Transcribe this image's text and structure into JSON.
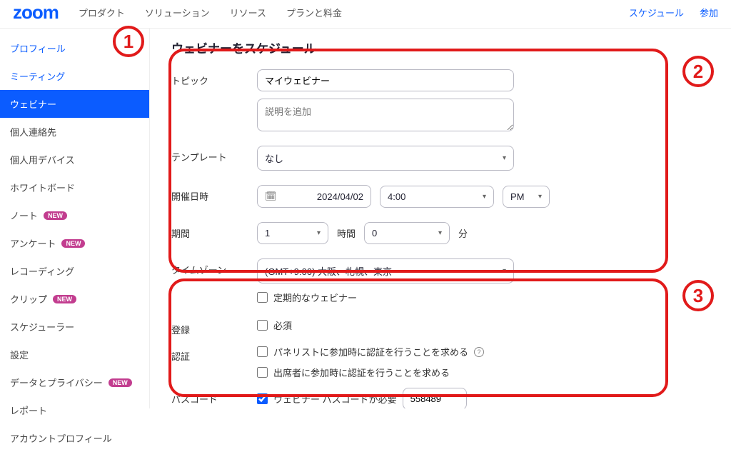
{
  "brand": "zoom",
  "topnav": {
    "links": [
      "プロダクト",
      "ソリューション",
      "リソース",
      "プランと料金"
    ],
    "right": [
      "スケジュール",
      "参加"
    ]
  },
  "sidebar": {
    "items": [
      {
        "label": "プロフィール",
        "active": false,
        "linkish": true,
        "new": false
      },
      {
        "label": "ミーティング",
        "active": false,
        "linkish": true,
        "new": false
      },
      {
        "label": "ウェビナー",
        "active": true,
        "linkish": false,
        "new": false
      },
      {
        "label": "個人連絡先",
        "active": false,
        "linkish": false,
        "new": false
      },
      {
        "label": "個人用デバイス",
        "active": false,
        "linkish": false,
        "new": false
      },
      {
        "label": "ホワイトボード",
        "active": false,
        "linkish": false,
        "new": false
      },
      {
        "label": "ノート",
        "active": false,
        "linkish": false,
        "new": true
      },
      {
        "label": "アンケート",
        "active": false,
        "linkish": false,
        "new": true
      },
      {
        "label": "レコーディング",
        "active": false,
        "linkish": false,
        "new": false
      },
      {
        "label": "クリップ",
        "active": false,
        "linkish": false,
        "new": true
      },
      {
        "label": "スケジューラー",
        "active": false,
        "linkish": false,
        "new": false
      },
      {
        "label": "設定",
        "active": false,
        "linkish": false,
        "new": false
      },
      {
        "label": "データとプライバシー",
        "active": false,
        "linkish": false,
        "new": true
      },
      {
        "label": "レポート",
        "active": false,
        "linkish": false,
        "new": false
      },
      {
        "label": "アカウントプロフィール",
        "active": false,
        "linkish": false,
        "new": false
      }
    ],
    "new_badge": "NEW"
  },
  "page": {
    "title": "ウェビナーをスケジュール",
    "labels": {
      "topic": "トピック",
      "template": "テンプレート",
      "datetime": "開催日時",
      "duration": "期間",
      "timezone": "タイムゾーン",
      "registration": "登録",
      "auth": "認証",
      "passcode": "パスコード"
    },
    "topic_value": "マイウェビナー",
    "desc_placeholder": "説明を追加",
    "template_value": "なし",
    "date_value": "2024/04/02",
    "time_value": "4:00",
    "ampm_value": "PM",
    "hours_value": "1",
    "hours_unit": "時間",
    "minutes_value": "0",
    "minutes_unit": "分",
    "timezone_value": "(GMT+9:00) 大阪、札幌、東京",
    "recurring_label": "定期的なウェビナー",
    "registration_required_label": "必須",
    "auth_panelist_label": "パネリストに参加時に認証を行うことを求める",
    "auth_attendee_label": "出席者に参加時に認証を行うことを求める",
    "passcode_require_label": "ウェビナー パスコードが必要",
    "passcode_value": "558489"
  },
  "annotations": {
    "n1": "1",
    "n2": "2",
    "n3": "3"
  }
}
